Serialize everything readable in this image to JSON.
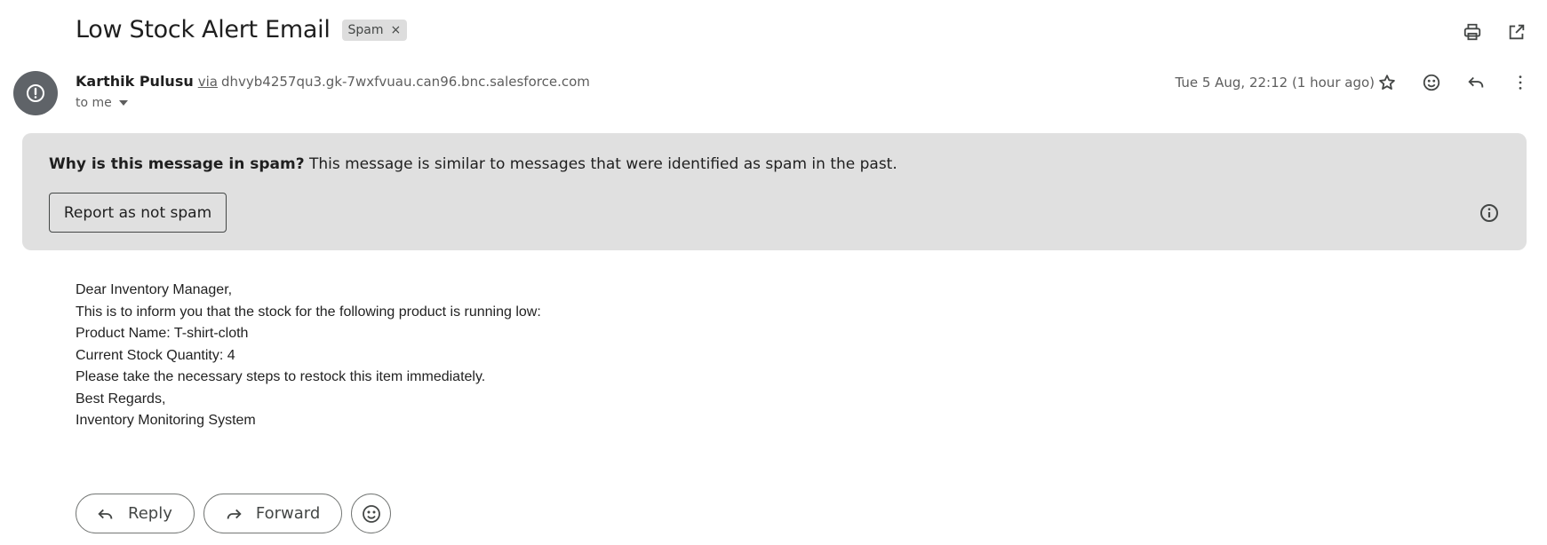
{
  "header": {
    "subject": "Low Stock Alert Email",
    "label": "Spam",
    "label_remove": "×"
  },
  "toolbar": {
    "icons": [
      "print-icon",
      "open-in-new-window-icon"
    ]
  },
  "message": {
    "sender_name": "Karthik Pulusu",
    "via_label": "via",
    "via_domain": "dhvyb4257qu3.gk-7wxfvuau.can96.bnc.salesforce.com",
    "recipient": "to me",
    "date": "Tue 5 Aug, 22:12 (1 hour ago)",
    "icons": [
      "star-icon",
      "emoji-reaction-icon",
      "reply-icon",
      "more-vert-icon"
    ]
  },
  "spam_notice": {
    "question": "Why is this message in spam?",
    "explanation": "This message is similar to messages that were identified as spam in the past.",
    "button_label": "Report as not spam"
  },
  "body": {
    "lines": [
      "Dear Inventory Manager,",
      "This is to inform you that the stock for the following product is running low:",
      "Product Name: T-shirt-cloth",
      "Current Stock Quantity: 4",
      "Please take the necessary steps to restock this item immediately.",
      "Best Regards,",
      "Inventory Monitoring System"
    ]
  },
  "actions": {
    "reply_label": "Reply",
    "forward_label": "Forward"
  },
  "colors": {
    "spam_box_bg": "#e0e0e0",
    "avatar_bg": "#5f6368",
    "label_chip_bg": "#dddddd"
  }
}
